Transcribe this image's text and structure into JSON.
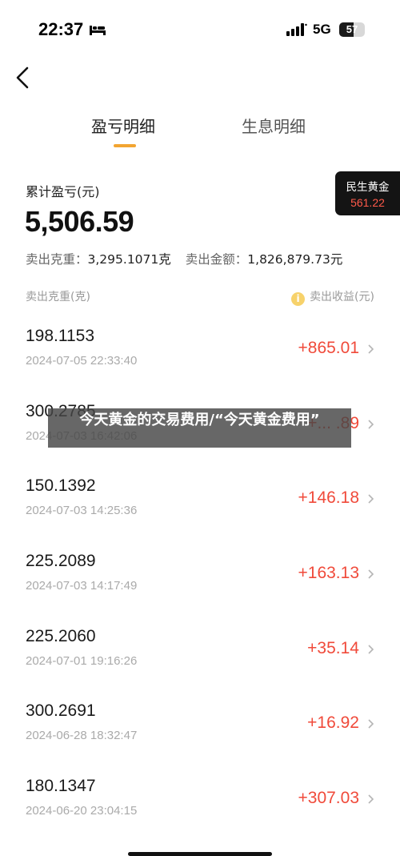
{
  "status_bar": {
    "time": "22:37",
    "network": "5G",
    "battery": "57",
    "battery_level_percent": 57,
    "icons": [
      "bed-icon",
      "signal-icon",
      "battery-icon"
    ]
  },
  "nav": {
    "back_icon": "chevron-left-icon"
  },
  "tabs": [
    {
      "label": "盈亏明细",
      "active": true
    },
    {
      "label": "生息明细",
      "active": false
    }
  ],
  "summary": {
    "label": "累计盈亏(元)",
    "total": "5,506.59",
    "sold_weight_label": "卖出克重：",
    "sold_weight_value": "3,295.1071克",
    "sold_amount_label": "卖出金额：",
    "sold_amount_value": "1,826,879.73元"
  },
  "price_badge": {
    "title": "民生黄金",
    "price": "561.22"
  },
  "list_header": {
    "left": "卖出克重(克)",
    "right": "卖出收益(元)",
    "info_icon": "info-icon"
  },
  "trades": [
    {
      "weight": "198.1153",
      "time": "2024-07-05 22:33:40",
      "profit": "+865.01"
    },
    {
      "weight": "300.2785",
      "time": "2024-07-03 16:42:06",
      "profit": "+... .89"
    },
    {
      "weight": "150.1392",
      "time": "2024-07-03 14:25:36",
      "profit": "+146.18"
    },
    {
      "weight": "225.2089",
      "time": "2024-07-03 14:17:49",
      "profit": "+163.13"
    },
    {
      "weight": "225.2060",
      "time": "2024-07-01 19:16:26",
      "profit": "+35.14"
    },
    {
      "weight": "300.2691",
      "time": "2024-06-28 18:32:47",
      "profit": "+16.92"
    },
    {
      "weight": "180.1347",
      "time": "2024-06-20 23:04:15",
      "profit": "+307.03"
    }
  ],
  "watermark": {
    "text": "今天黄金的交易费用/“今天黄金费用”"
  },
  "colors": {
    "accent": "#f2a531",
    "profit": "#f04a3a",
    "badge_bg": "#141414",
    "badge_price": "#ff5a4a"
  }
}
